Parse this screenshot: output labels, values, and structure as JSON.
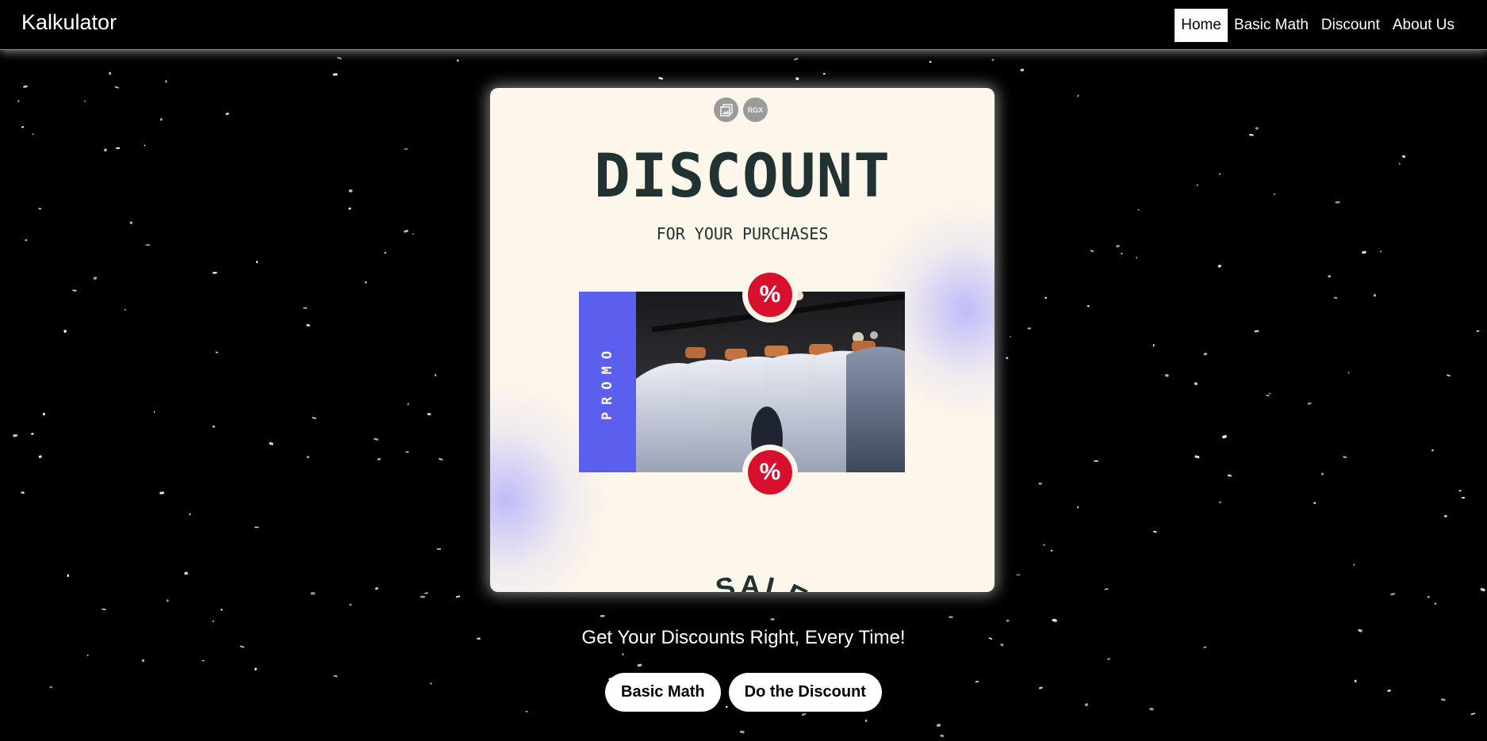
{
  "navbar": {
    "brand": "Kalkulator",
    "links": [
      {
        "label": "Home",
        "active": true
      },
      {
        "label": "Basic Math",
        "active": false
      },
      {
        "label": "Discount",
        "active": false
      },
      {
        "label": "About Us",
        "active": false
      }
    ]
  },
  "hero_card": {
    "icons": [
      {
        "name": "gallery-icon"
      },
      {
        "name": "rgx-icon",
        "text": "RGX"
      }
    ],
    "title": "DISCOUNT",
    "subtitle": "FOR YOUR PURCHASES",
    "promo_label": "PROMO",
    "badge_symbol": "%",
    "photo_alt": "shirts-on-rack-photo",
    "arc_text": "SALE • SALE • S"
  },
  "tagline": "Get Your Discounts Right, Every Time!",
  "buttons": {
    "basic_math": "Basic Math",
    "discount": "Do the Discount"
  },
  "colors": {
    "background": "#000000",
    "card_background": "#fdf6ea",
    "title_text": "#203232",
    "promo_band": "#5a5fee",
    "badge_red": "#d8102e"
  }
}
